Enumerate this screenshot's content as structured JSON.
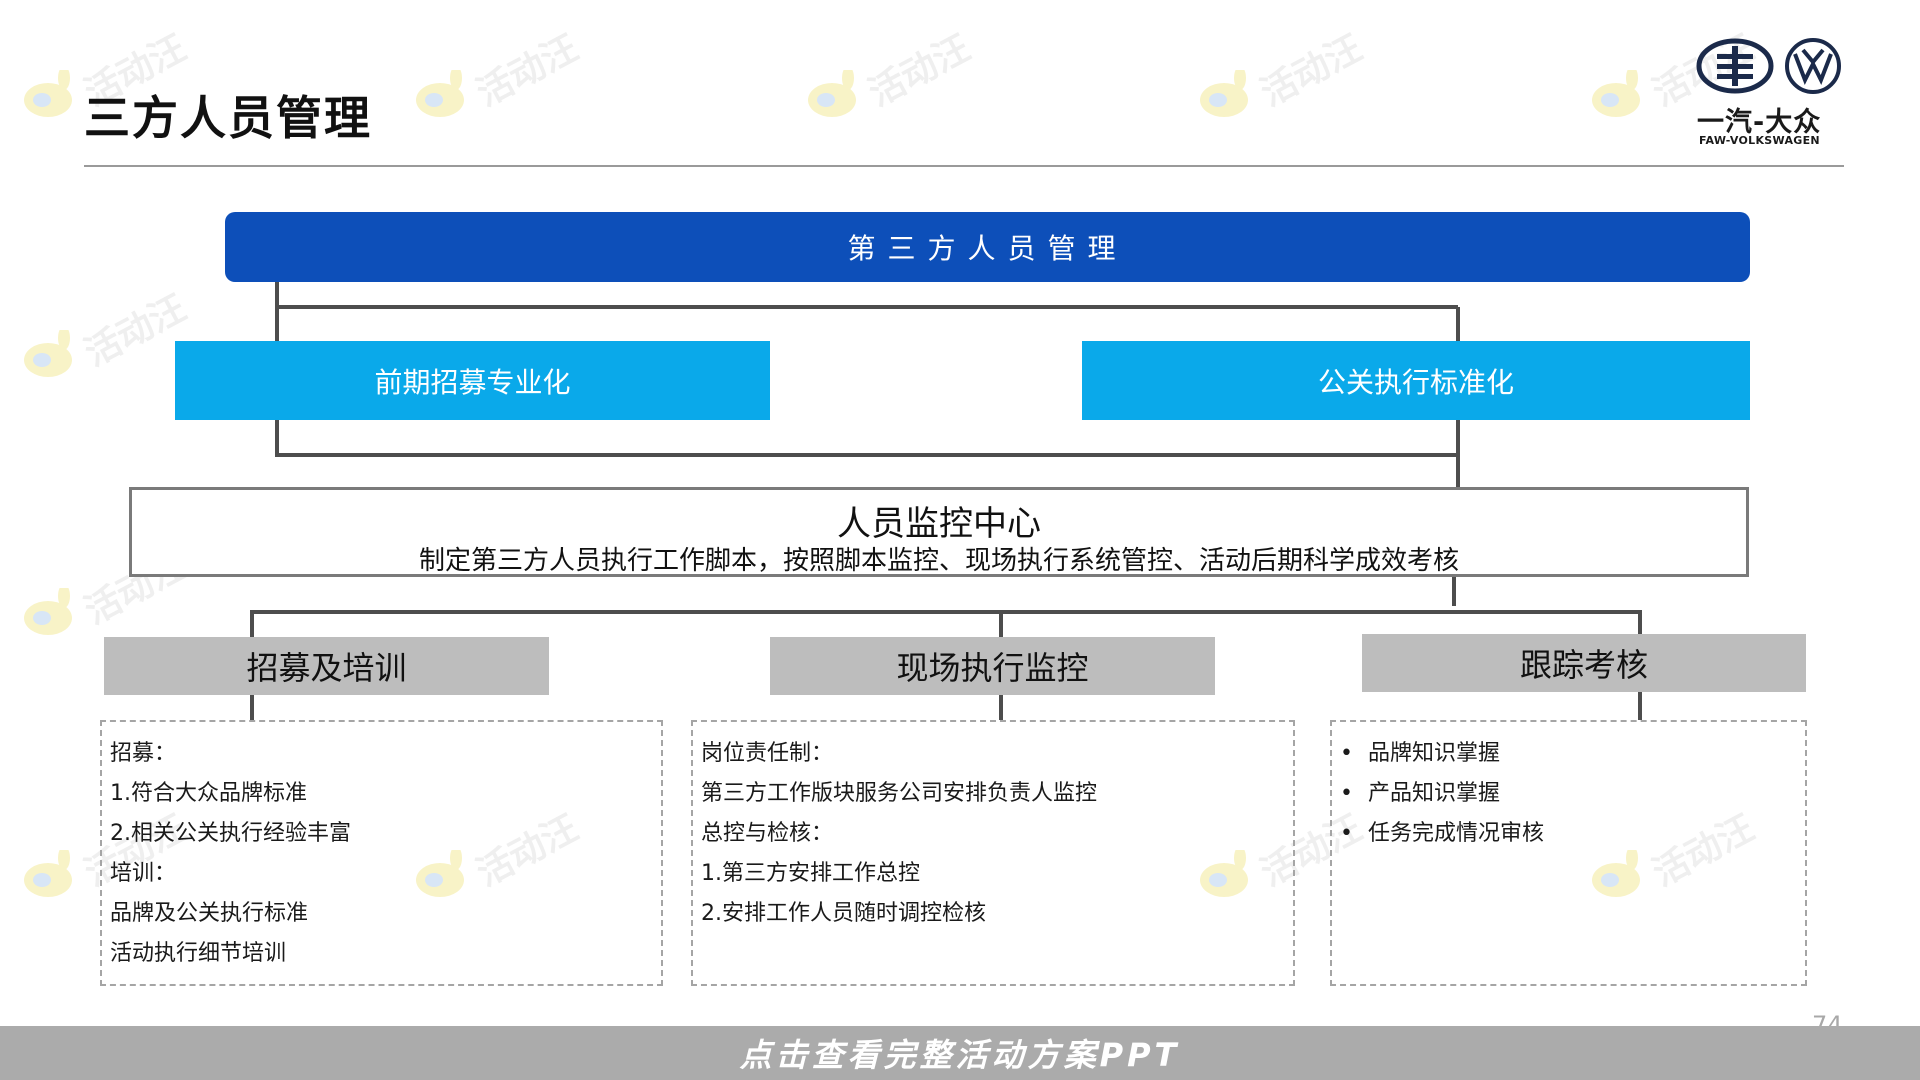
{
  "header": {
    "title": "三方人员管理",
    "brand_cn": "一汽-大众",
    "brand_en": "FAW-VOLKSWAGEN"
  },
  "diagram": {
    "top": "第三方人员管理",
    "left_branch": "前期招募专业化",
    "right_branch": "公关执行标准化",
    "center": {
      "title": "人员监控中心",
      "description": "制定第三方人员执行工作脚本，按照脚本监控、现场执行系统管控、活动后期科学成效考核"
    },
    "columns": [
      {
        "heading": "招募及培训",
        "lines": [
          "招募：",
          "1.符合大众品牌标准",
          "2.相关公关执行经验丰富",
          "培训：",
          "品牌及公关执行标准",
          "活动执行细节培训"
        ]
      },
      {
        "heading": "现场执行监控",
        "lines": [
          "岗位责任制：",
          "第三方工作版块服务公司安排负责人监控",
          "总控与检核：",
          "1.第三方安排工作总控",
          "2.安排工作人员随时调控检核"
        ]
      },
      {
        "heading": "跟踪考核",
        "bullets": [
          "品牌知识掌握",
          "产品知识掌握",
          "任务完成情况审核"
        ]
      }
    ]
  },
  "footer": {
    "page_number": "74",
    "banner": "点击查看完整活动方案PPT"
  },
  "watermark": {
    "text": "活动汪"
  },
  "colors": {
    "dark_blue": "#0d4fb9",
    "light_blue": "#0aa9ea",
    "grey_header": "#bdbdbd",
    "connector": "#4d4d4d"
  }
}
